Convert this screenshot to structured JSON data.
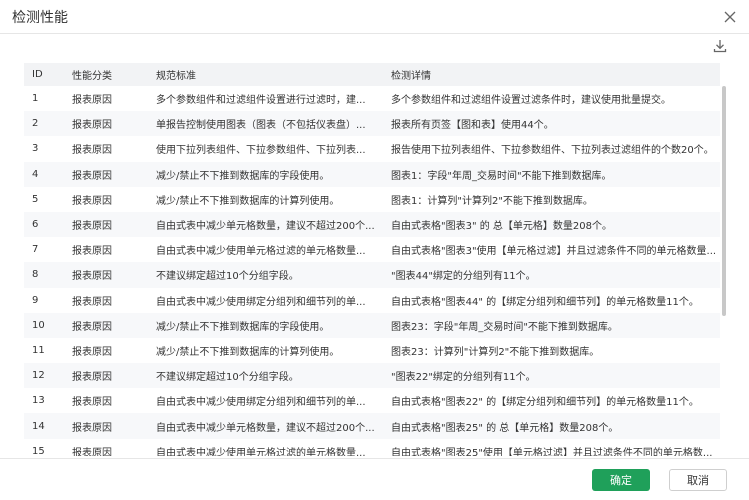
{
  "dialog": {
    "title": "检测性能",
    "confirm_label": "确定",
    "cancel_label": "取消"
  },
  "icons": {
    "close": "close-icon",
    "download": "download-icon"
  },
  "colors": {
    "primary": "#1fa05a",
    "header_bg": "#f2f3f5",
    "stripe_bg": "#f7f8fa"
  },
  "table": {
    "headers": [
      "ID",
      "性能分类",
      "规范标准",
      "检测详情"
    ],
    "rows": [
      {
        "id": "1",
        "category": "报表原因",
        "standard": "多个参数组件和过滤组件设置进行过滤时，建...",
        "detail": "多个参数组件和过滤组件设置过滤条件时，建议使用批量提交。"
      },
      {
        "id": "2",
        "category": "报表原因",
        "standard": "单报告控制使用图表（图表（不包括仪表盘）...",
        "detail": "报表所有页签【图和表】使用44个。"
      },
      {
        "id": "3",
        "category": "报表原因",
        "standard": "使用下拉列表组件、下拉参数组件、下拉列表...",
        "detail": "报告使用下拉列表组件、下拉参数组件、下拉列表过滤组件的个数20个。"
      },
      {
        "id": "4",
        "category": "报表原因",
        "standard": "减少/禁止不下推到数据库的字段使用。",
        "detail": "图表1：字段\"年周_交易时间\"不能下推到数据库。"
      },
      {
        "id": "5",
        "category": "报表原因",
        "standard": "减少/禁止不下推到数据库的计算列使用。",
        "detail": "图表1：计算列\"计算列2\"不能下推到数据库。"
      },
      {
        "id": "6",
        "category": "报表原因",
        "standard": "自由式表中减少单元格数量，建议不超过200个...",
        "detail": "自由式表格\"图表3\" 的 总【单元格】数量208个。"
      },
      {
        "id": "7",
        "category": "报表原因",
        "standard": "自由式表中减少使用单元格过滤的单元格数量...",
        "detail": "自由式表格\"图表3\"使用【单元格过滤】并且过滤条件不同的单元格数量..."
      },
      {
        "id": "8",
        "category": "报表原因",
        "standard": "不建议绑定超过10个分组字段。",
        "detail": "\"图表44\"绑定的分组列有11个。"
      },
      {
        "id": "9",
        "category": "报表原因",
        "standard": "自由式表中减少使用绑定分组列和细节列的单...",
        "detail": "自由式表格\"图表44\" 的【绑定分组列和细节列】的单元格数量11个。"
      },
      {
        "id": "10",
        "category": "报表原因",
        "standard": "减少/禁止不下推到数据库的字段使用。",
        "detail": "图表23：字段\"年周_交易时间\"不能下推到数据库。"
      },
      {
        "id": "11",
        "category": "报表原因",
        "standard": "减少/禁止不下推到数据库的计算列使用。",
        "detail": "图表23：计算列\"计算列2\"不能下推到数据库。"
      },
      {
        "id": "12",
        "category": "报表原因",
        "standard": "不建议绑定超过10个分组字段。",
        "detail": "\"图表22\"绑定的分组列有11个。"
      },
      {
        "id": "13",
        "category": "报表原因",
        "standard": "自由式表中减少使用绑定分组列和细节列的单...",
        "detail": "自由式表格\"图表22\" 的【绑定分组列和细节列】的单元格数量11个。"
      },
      {
        "id": "14",
        "category": "报表原因",
        "standard": "自由式表中减少单元格数量，建议不超过200个...",
        "detail": "自由式表格\"图表25\" 的 总【单元格】数量208个。"
      },
      {
        "id": "15",
        "category": "报表原因",
        "standard": "自由式表中减少使用单元格过滤的单元格数量...",
        "detail": "自由式表格\"图表25\"使用【单元格过滤】并且过滤条件不同的单元格数..."
      }
    ]
  }
}
